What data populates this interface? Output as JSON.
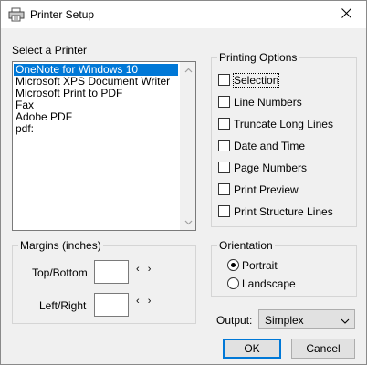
{
  "window": {
    "title": "Printer Setup",
    "close_glyph": "✕"
  },
  "printer_group": {
    "label": "Select a Printer",
    "printers": [
      "OneNote for Windows 10",
      "Microsoft XPS Document Writer",
      "Microsoft Print to PDF",
      "Fax",
      "Adobe PDF",
      "pdf:"
    ],
    "selected_index": 0
  },
  "printing_options": {
    "label": "Printing Options",
    "options": [
      {
        "label": "Selection",
        "checked": false
      },
      {
        "label": "Line Numbers",
        "checked": false
      },
      {
        "label": "Truncate Long Lines",
        "checked": false
      },
      {
        "label": "Date and Time",
        "checked": false
      },
      {
        "label": "Page Numbers",
        "checked": false
      },
      {
        "label": "Print Preview",
        "checked": false
      },
      {
        "label": "Print Structure Lines",
        "checked": false
      }
    ]
  },
  "margins": {
    "label": "Margins (inches)",
    "top_bottom_label": "Top/Bottom",
    "top_bottom_value": "",
    "left_right_label": "Left/Right",
    "left_right_value": "",
    "spinner_glyph": "‹ ›"
  },
  "orientation": {
    "label": "Orientation",
    "portrait_label": "Portrait",
    "landscape_label": "Landscape",
    "selected": "Portrait"
  },
  "output": {
    "label": "Output:",
    "value": "Simplex"
  },
  "buttons": {
    "ok": "OK",
    "cancel": "Cancel"
  },
  "icons": {
    "title_icon": "printer-icon",
    "scroll_up": "chevron-up-icon",
    "scroll_down": "chevron-down-icon",
    "combo_arrow": "chevron-down-icon"
  },
  "colors": {
    "selection": "#0078d7",
    "accent": "#0078d7"
  }
}
